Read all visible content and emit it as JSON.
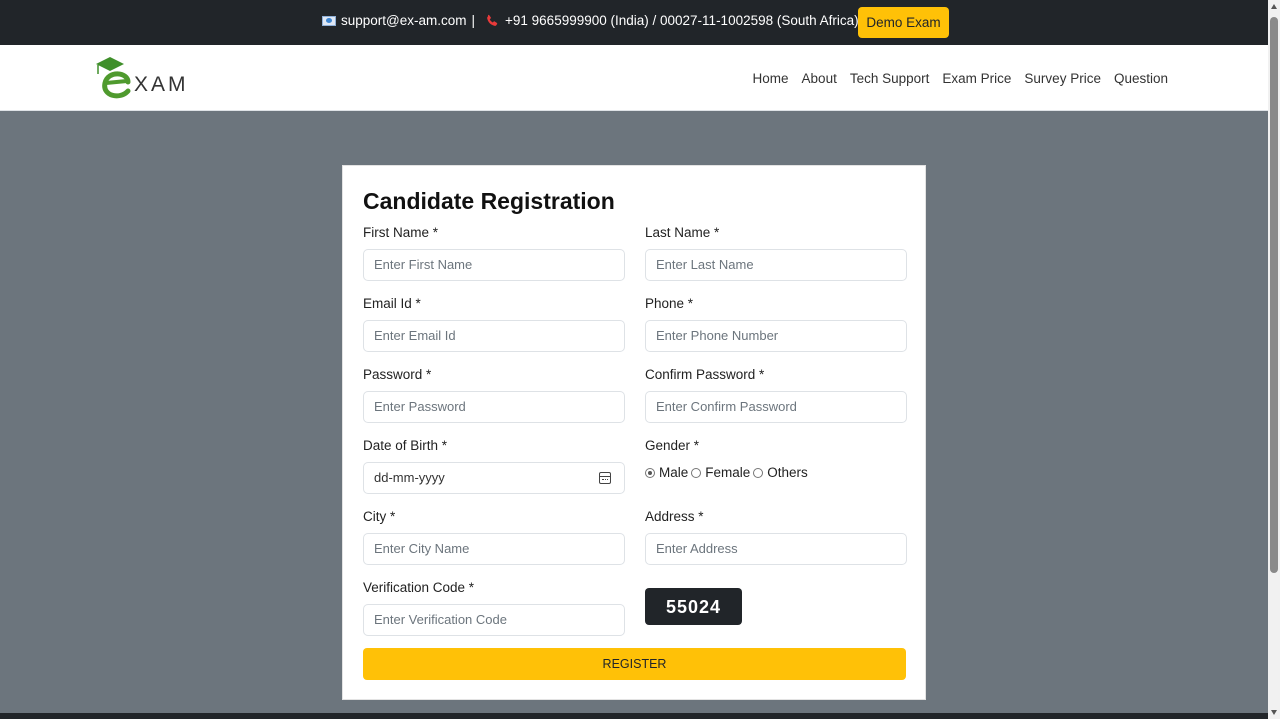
{
  "topbar": {
    "email": "support@ex-am.com",
    "separator": "|",
    "phone": "+91 9665999900 (India) / 00027-11-1002598 (South Africa)",
    "demo_button": "Demo Exam",
    "icons": [
      "mail-icon",
      "phone-icon"
    ],
    "accent": "#ffc107"
  },
  "nav": {
    "logo_text": "XAM",
    "links": [
      "Home",
      "About",
      "Tech Support",
      "Exam Price",
      "Survey Price",
      "Question"
    ]
  },
  "form": {
    "title": "Candidate Registration",
    "first_name": {
      "label": "First Name *",
      "placeholder": "Enter First Name"
    },
    "last_name": {
      "label": "Last Name *",
      "placeholder": "Enter Last Name"
    },
    "email": {
      "label": "Email Id *",
      "placeholder": "Enter Email Id"
    },
    "phone": {
      "label": "Phone *",
      "placeholder": "Enter Phone Number"
    },
    "password": {
      "label": "Password *",
      "placeholder": "Enter Password"
    },
    "confirm_password": {
      "label": "Confirm Password *",
      "placeholder": "Enter Confirm Password"
    },
    "dob": {
      "label": "Date of Birth *",
      "value": "dd-mm-yyyy"
    },
    "gender": {
      "label": "Gender *",
      "options": [
        "Male",
        "Female",
        "Others"
      ],
      "selected": "Male"
    },
    "city": {
      "label": "City *",
      "placeholder": "Enter City Name"
    },
    "address": {
      "label": "Address *",
      "placeholder": "Enter Address"
    },
    "verification": {
      "label": "Verification Code *",
      "placeholder": "Enter Verification Code"
    },
    "captcha": "55024",
    "register_button": "REGISTER"
  },
  "colors": {
    "topbar_bg": "#212529",
    "page_bg": "#6c757d",
    "button": "#ffc107",
    "captcha_bg": "#212529"
  }
}
